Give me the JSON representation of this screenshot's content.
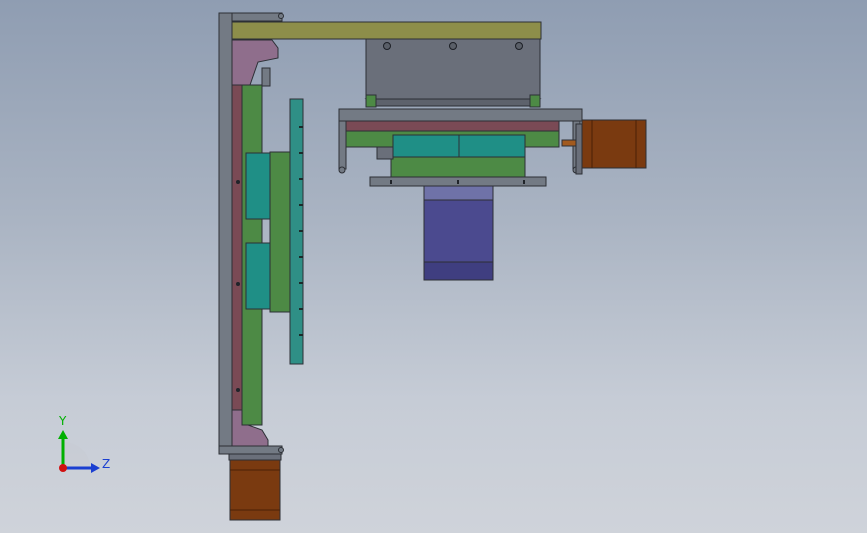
{
  "window": {
    "title": ""
  },
  "triad": {
    "y_label": "Y",
    "z_label": "Z",
    "colors": {
      "y": "#00b000",
      "z": "#1a3fd1",
      "x": "#d01010"
    }
  },
  "palette": {
    "background_top": "#8f9db2",
    "background_bottom": "#cfd3da",
    "frame_gray": "#6f7680",
    "olive_bar": "#8d8e4a",
    "mauve_plate": "#8f6e8c",
    "maroon_rail": "#7a4a55",
    "green_plate": "#4d8a45",
    "teal_carriage": "#1f8f86",
    "motor_brown": "#7a3a10",
    "slate_block": "#6a6f7a",
    "indigo_block": "#4b4a8f"
  }
}
